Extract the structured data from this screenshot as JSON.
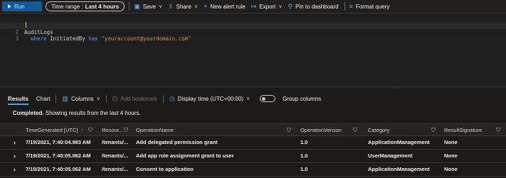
{
  "toolbar": {
    "run_label": "Run",
    "time_range_prefix": "Time range :",
    "time_range_value": "Last 4 hours",
    "save_label": "Save",
    "share_label": "Share",
    "new_alert_label": "New alert rule",
    "export_label": "Export",
    "pin_label": "Pin to dashboard",
    "format_label": "Format query"
  },
  "editor": {
    "lines": [
      {
        "num": "1",
        "text": "AuditLogs"
      },
      {
        "num": "2",
        "kw1": "where",
        "ident": " InitiatedBy ",
        "kw2": "has",
        "str": " \"youraccount@yourdomain.com\""
      },
      {
        "num": "3",
        "text": ""
      }
    ]
  },
  "results_toolbar": {
    "tab_results": "Results",
    "tab_chart": "Chart",
    "columns_label": "Columns",
    "add_bookmark_label": "Add bookmark",
    "display_time_label": "Display time (UTC+00:00)",
    "group_columns_label": "Group columns"
  },
  "status": {
    "bold": "Completed.",
    "text": " Showing results from the last 4 hours."
  },
  "table": {
    "headers": [
      "TimeGenerated [UTC]",
      "Resour...",
      "OperationName",
      "OperationVersion",
      "Category",
      "ResultSignature"
    ],
    "sort_indicator": "↑",
    "rows": [
      [
        "7/19/2021, 7:40:04.983 AM",
        "/tenants/...",
        "Add delegated permission grant",
        "1.0",
        "ApplicationManagement",
        "None"
      ],
      [
        "7/19/2021, 7:40:05.062 AM",
        "/tenants/...",
        "Add app role assignment grant to user",
        "1.0",
        "UserManagement",
        "None"
      ],
      [
        "7/19/2021, 7:40:05.062 AM",
        "/tenants/...",
        "Consent to application",
        "1.0",
        "ApplicationManagement",
        "None"
      ]
    ]
  },
  "colors": {
    "accent": "#479ef5",
    "run_button": "#0e5a9c",
    "background": "#1b1a19"
  },
  "icons": [
    "play-icon",
    "save-icon",
    "share-icon",
    "plus-icon",
    "export-icon",
    "pin-icon",
    "format-icon",
    "columns-icon",
    "bookmark-icon",
    "clock-icon",
    "filter-icon",
    "chevron-right-icon"
  ]
}
